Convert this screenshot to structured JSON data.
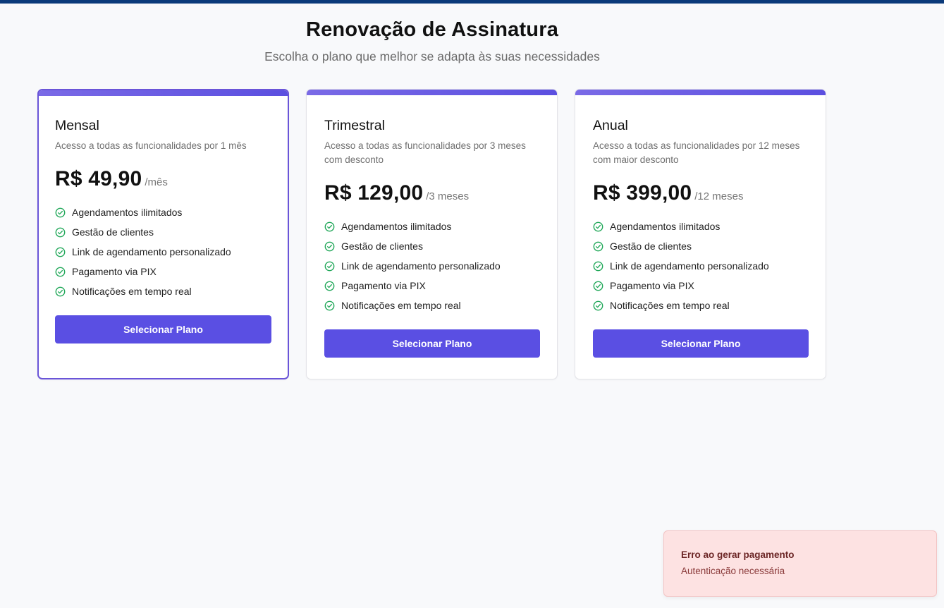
{
  "header": {
    "title": "Renovação de Assinatura",
    "subtitle": "Escolha o plano que melhor se adapta às suas necessidades"
  },
  "colors": {
    "top_bar": "#0b3a7a",
    "accent": "#5a4fe3",
    "check": "#22a85a",
    "toast_bg": "#fde2e2"
  },
  "plans": [
    {
      "name": "Mensal",
      "description": "Acesso a todas as funcionalidades por 1 mês",
      "price": "R$ 49,90",
      "period": "/mês",
      "selected": true,
      "features": [
        "Agendamentos ilimitados",
        "Gestão de clientes",
        "Link de agendamento personalizado",
        "Pagamento via PIX",
        "Notificações em tempo real"
      ],
      "button_label": "Selecionar Plano"
    },
    {
      "name": "Trimestral",
      "description": "Acesso a todas as funcionalidades por 3 meses com desconto",
      "price": "R$ 129,00",
      "period": "/3 meses",
      "selected": false,
      "features": [
        "Agendamentos ilimitados",
        "Gestão de clientes",
        "Link de agendamento personalizado",
        "Pagamento via PIX",
        "Notificações em tempo real"
      ],
      "button_label": "Selecionar Plano"
    },
    {
      "name": "Anual",
      "description": "Acesso a todas as funcionalidades por 12 meses com maior desconto",
      "price": "R$ 399,00",
      "period": "/12 meses",
      "selected": false,
      "features": [
        "Agendamentos ilimitados",
        "Gestão de clientes",
        "Link de agendamento personalizado",
        "Pagamento via PIX",
        "Notificações em tempo real"
      ],
      "button_label": "Selecionar Plano"
    }
  ],
  "toast": {
    "title": "Erro ao gerar pagamento",
    "message": "Autenticação necessária"
  }
}
